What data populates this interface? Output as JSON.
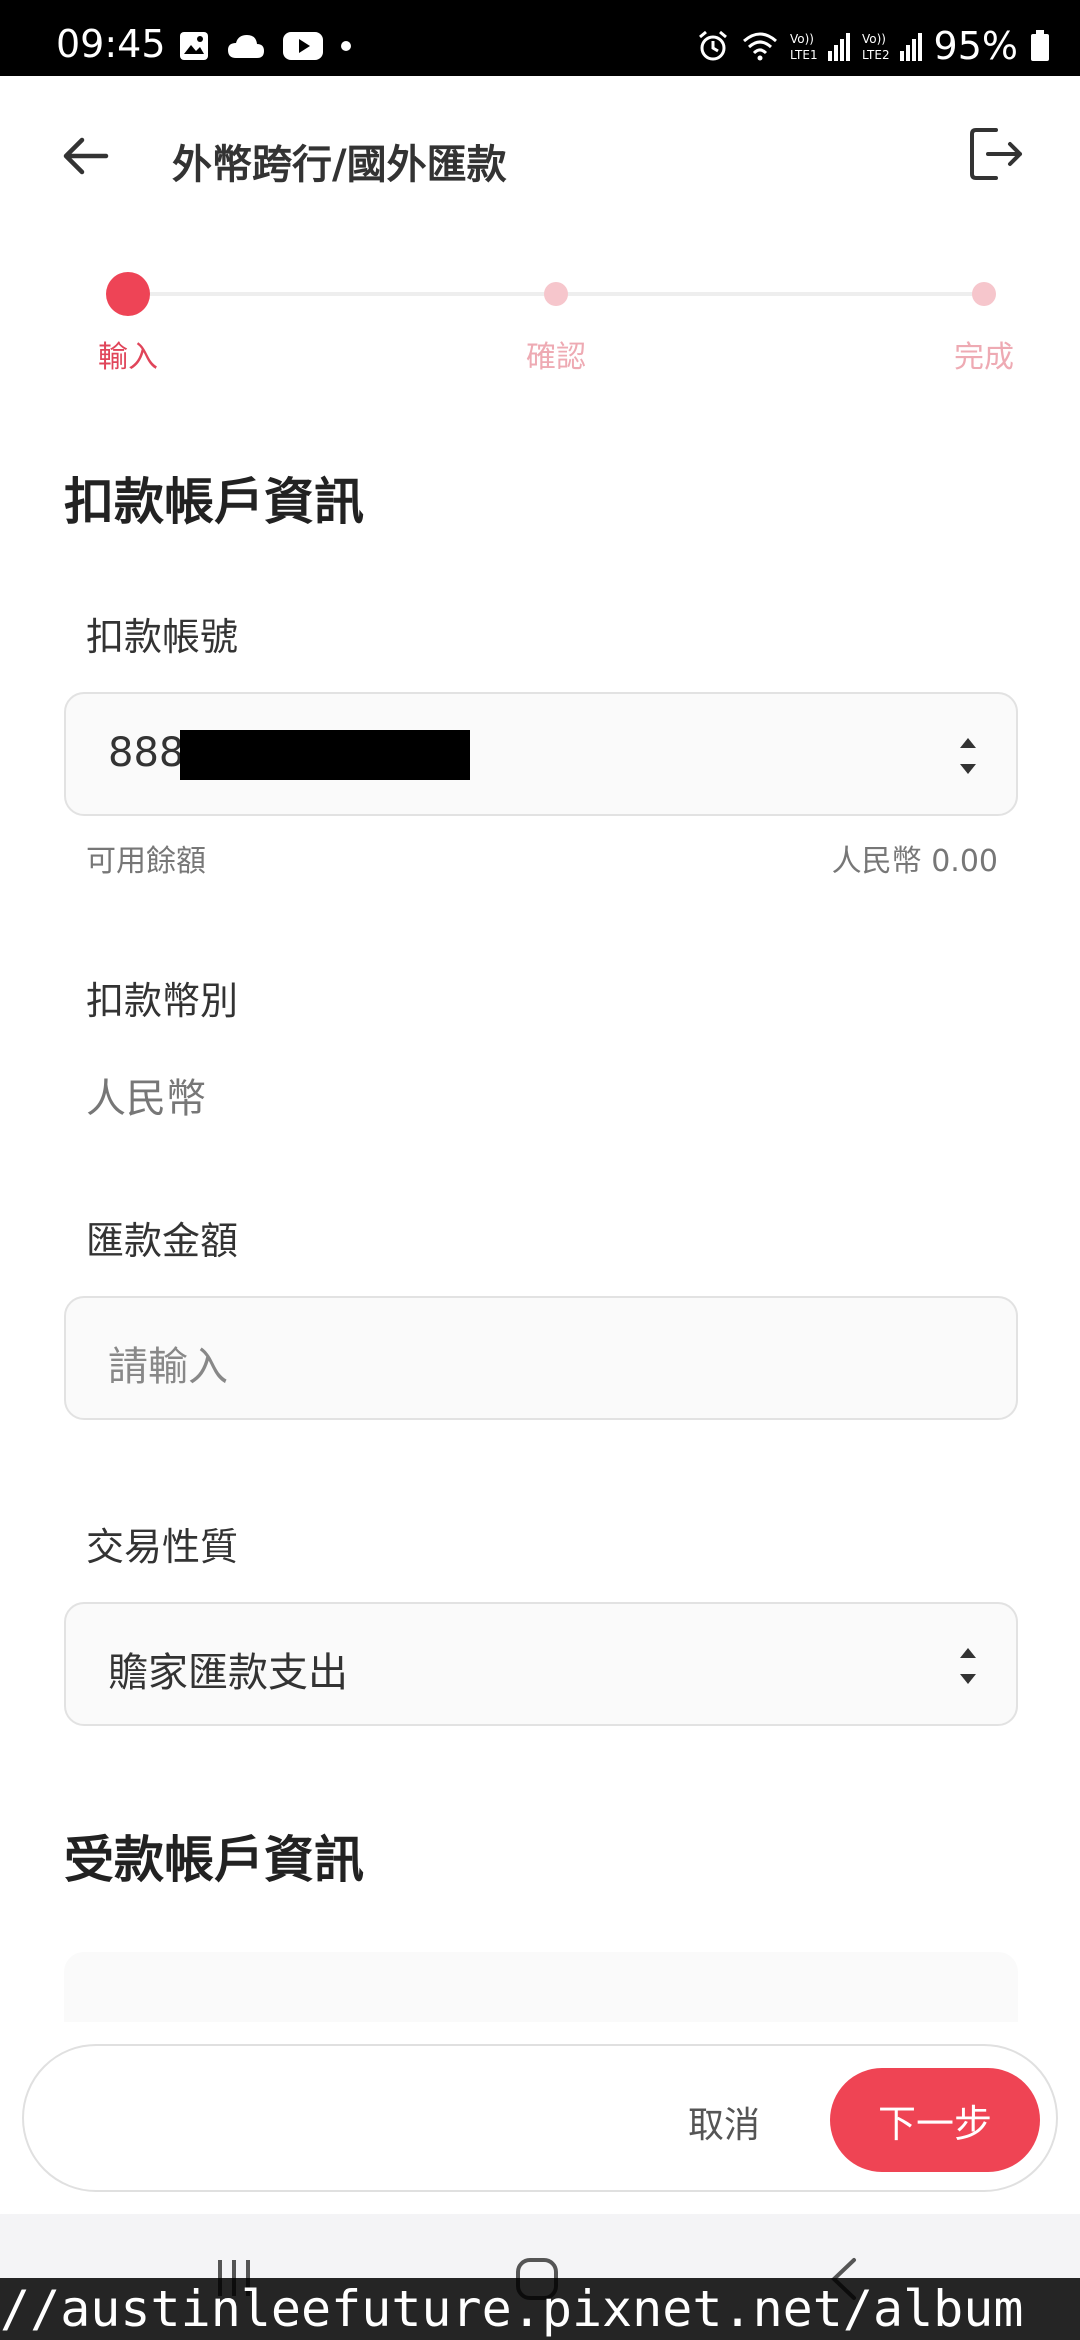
{
  "status_bar": {
    "time": "09:45",
    "battery": "95%",
    "sim1": "LTE1",
    "sim2": "LTE2",
    "volte": "Vo))"
  },
  "header": {
    "title": "外幣跨行/國外匯款"
  },
  "stepper": {
    "steps": [
      {
        "label": "輸入",
        "active": true
      },
      {
        "label": "確認",
        "active": false
      },
      {
        "label": "完成",
        "active": false
      }
    ]
  },
  "debit_section": {
    "title": "扣款帳戶資訊",
    "account_label": "扣款帳號",
    "account_value": "888",
    "available_label": "可用餘額",
    "available_value": "人民幣 0.00",
    "currency_label": "扣款幣別",
    "currency_value": "人民幣",
    "amount_label": "匯款金額",
    "amount_placeholder": "請輸入",
    "nature_label": "交易性質",
    "nature_value": "贍家匯款支出"
  },
  "payee_section": {
    "title": "受款帳戶資訊"
  },
  "actions": {
    "cancel": "取消",
    "next": "下一步"
  },
  "watermark": "//austinleefuture.pixnet.net/album",
  "colors": {
    "accent": "#ee4456",
    "accent_light": "#f6c6cc"
  }
}
